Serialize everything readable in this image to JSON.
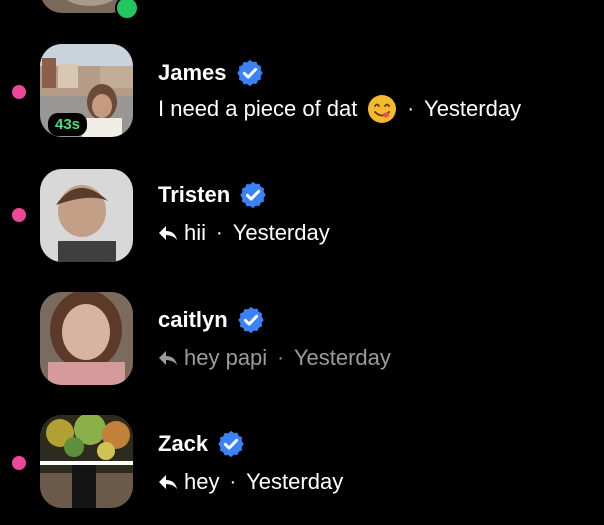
{
  "colors": {
    "unread": "#ec4899",
    "online": "#22c55e",
    "verified": "#3b82f6",
    "timer": "#4ade80"
  },
  "chats": [
    {
      "name": "James",
      "message": "I need a piece of dat",
      "emoji": "yum-face-icon",
      "time": "Yesterday",
      "badge": "43s",
      "unread": true,
      "read": false
    },
    {
      "name": "Tristen",
      "message": "hii",
      "time": "Yesterday",
      "unread": true,
      "read": false
    },
    {
      "name": "caitlyn",
      "message": "hey papi",
      "time": "Yesterday",
      "unread": false,
      "read": true
    },
    {
      "name": "Zack",
      "message": "hey",
      "time": "Yesterday",
      "unread": true,
      "read": false
    }
  ],
  "icons": {
    "verified": "verified-badge-icon",
    "reply": "reply-arrow-icon"
  },
  "separator": "·"
}
